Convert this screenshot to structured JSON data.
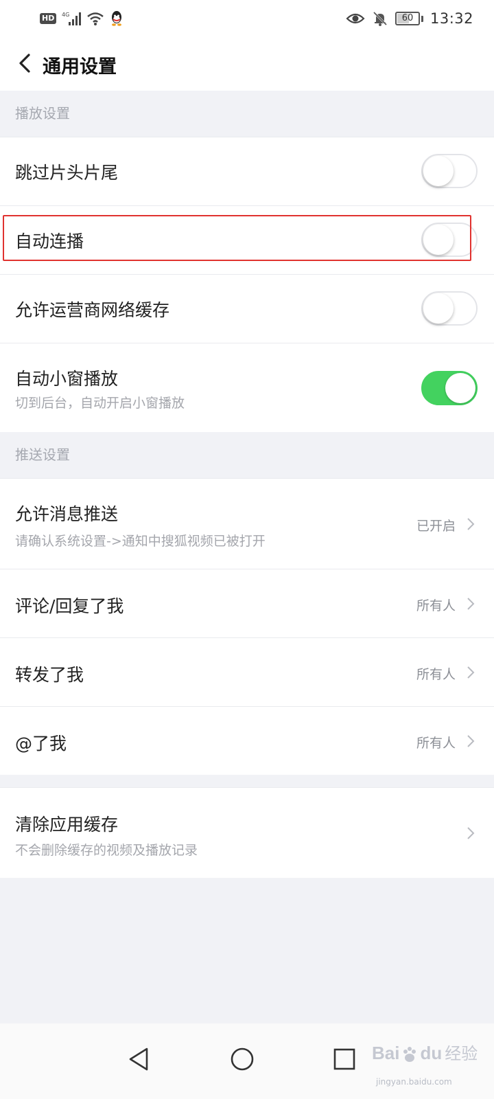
{
  "status_bar": {
    "hd": "HD",
    "network": "4G",
    "battery": "60",
    "battery_level_percent": 60,
    "time": "13:32",
    "icons": [
      "hd-icon",
      "signal-icon",
      "wifi-icon",
      "qq-icon",
      "eye-icon",
      "mute-bell-icon",
      "battery-icon"
    ]
  },
  "header": {
    "title": "通用设置",
    "back_icon": "chevron-left-icon"
  },
  "sections": {
    "playback": {
      "header": "播放设置",
      "skip_intro": {
        "label": "跳过片头片尾",
        "on": false
      },
      "autoplay": {
        "label": "自动连播",
        "on": false,
        "highlighted": true,
        "highlight_color": "#e0322f"
      },
      "carrier_cache": {
        "label": "允许运营商网络缓存",
        "on": false
      },
      "mini_window": {
        "label": "自动小窗播放",
        "sub": "切到后台，自动开启小窗播放",
        "on": true
      }
    },
    "push": {
      "header": "推送设置",
      "allow_push": {
        "label": "允许消息推送",
        "sub": "请确认系统设置->通知中搜狐视频已被打开",
        "value": "已开启"
      },
      "comment_reply": {
        "label": "评论/回复了我",
        "value": "所有人"
      },
      "repost": {
        "label": "转发了我",
        "value": "所有人"
      },
      "mention": {
        "label": "@了我",
        "value": "所有人"
      }
    },
    "cache": {
      "clear_cache": {
        "label": "清除应用缓存",
        "sub": "不会删除缓存的视频及播放记录"
      }
    }
  },
  "bottom_nav": {
    "icons": [
      "back-triangle-icon",
      "home-circle-icon",
      "recents-square-icon"
    ]
  },
  "watermark": {
    "brand": "Bai",
    "brand2": "du",
    "cn": "经验",
    "url": "jingyan.baidu.com"
  },
  "colors": {
    "toggle_on": "#43d25f",
    "background": "#f1f2f6",
    "highlight": "#e0322f"
  }
}
